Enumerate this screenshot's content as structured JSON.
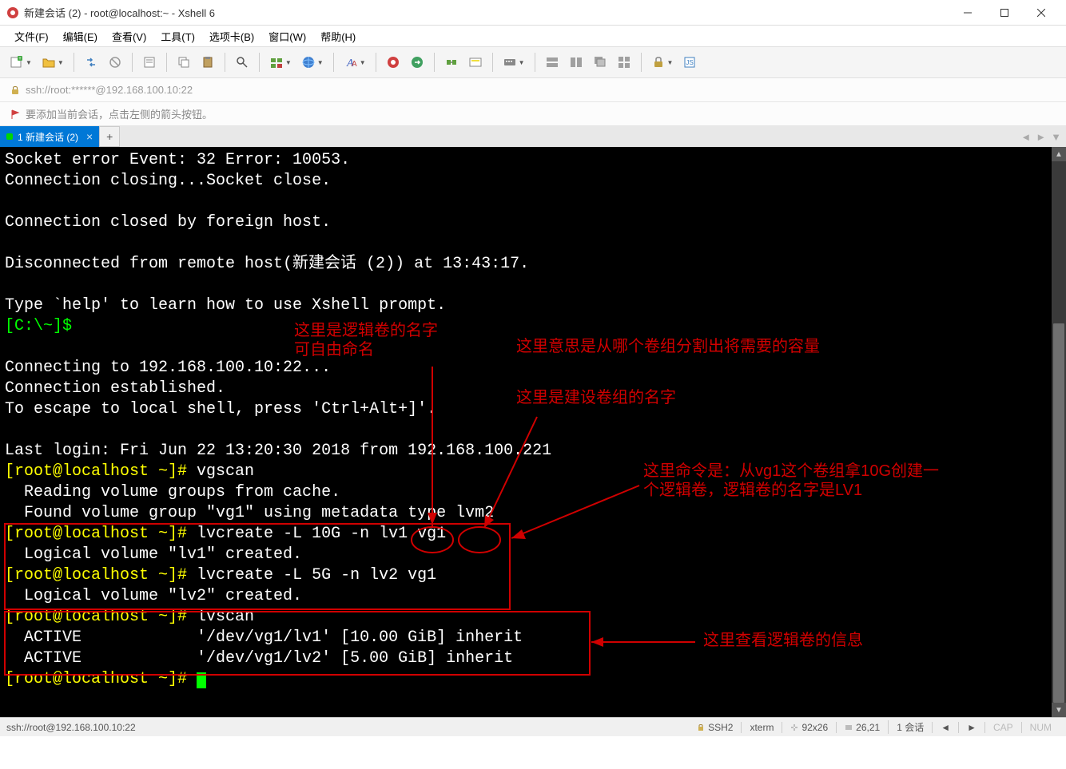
{
  "titlebar": {
    "text": "新建会话 (2) - root@localhost:~ - Xshell 6"
  },
  "menu": {
    "file": "文件(F)",
    "edit": "编辑(E)",
    "view": "查看(V)",
    "tools": "工具(T)",
    "tabs": "选项卡(B)",
    "window": "窗口(W)",
    "help": "帮助(H)"
  },
  "addressbar": {
    "text": "ssh://root:******@192.168.100.10:22"
  },
  "hintbar": {
    "text": "要添加当前会话，点击左侧的箭头按钮。"
  },
  "tab": {
    "label": "1 新建会话 (2)"
  },
  "terminal": {
    "lines": [
      {
        "t": "Socket error Event: 32 Error: 10053."
      },
      {
        "t": "Connection closing...Socket close."
      },
      {
        "t": ""
      },
      {
        "t": "Connection closed by foreign host."
      },
      {
        "t": ""
      },
      {
        "t": "Disconnected from remote host(新建会话 (2)) at 13:43:17."
      },
      {
        "t": ""
      },
      {
        "t": "Type `help' to learn how to use Xshell prompt."
      },
      {
        "prompt1": "[C:\\~]$ "
      },
      {
        "t": ""
      },
      {
        "t": "Connecting to 192.168.100.10:22..."
      },
      {
        "t": "Connection established."
      },
      {
        "t": "To escape to local shell, press 'Ctrl+Alt+]'."
      },
      {
        "t": ""
      },
      {
        "t": "Last login: Fri Jun 22 13:20:30 2018 from 192.168.100.221"
      },
      {
        "prompt2": "[root@localhost ~]# ",
        "cmd": "vgscan"
      },
      {
        "t": "  Reading volume groups from cache."
      },
      {
        "t": "  Found volume group \"vg1\" using metadata type lvm2"
      },
      {
        "prompt2": "[root@localhost ~]# ",
        "cmd": "lvcreate -L 10G -n lv1 vg1"
      },
      {
        "t": "  Logical volume \"lv1\" created."
      },
      {
        "prompt2": "[root@localhost ~]# ",
        "cmd": "lvcreate -L 5G -n lv2 vg1"
      },
      {
        "t": "  Logical volume \"lv2\" created."
      },
      {
        "prompt2": "[root@localhost ~]# ",
        "cmd": "lvscan"
      },
      {
        "t": "  ACTIVE            '/dev/vg1/lv1' [10.00 GiB] inherit"
      },
      {
        "t": "  ACTIVE            '/dev/vg1/lv2' [5.00 GiB] inherit"
      },
      {
        "prompt2": "[root@localhost ~]# ",
        "cursor": true
      }
    ]
  },
  "annotations": {
    "a1_l1": "这里是逻辑卷的名字",
    "a1_l2": "可自由命名",
    "a2": "这里意思是从哪个卷组分割出将需要的容量",
    "a3": "这里是建设卷组的名字",
    "a4_l1": "这里命令是：从vg1这个卷组拿10G创建一",
    "a4_l2": "个逻辑卷，逻辑卷的名字是LV1",
    "a5": "这里查看逻辑卷的信息"
  },
  "statusbar": {
    "conn": "ssh://root@192.168.100.10:22",
    "proto": "SSH2",
    "term": "xterm",
    "size": "92x26",
    "pos": "26,21",
    "sessions": "1 会话",
    "cap": "CAP",
    "num": "NUM"
  }
}
